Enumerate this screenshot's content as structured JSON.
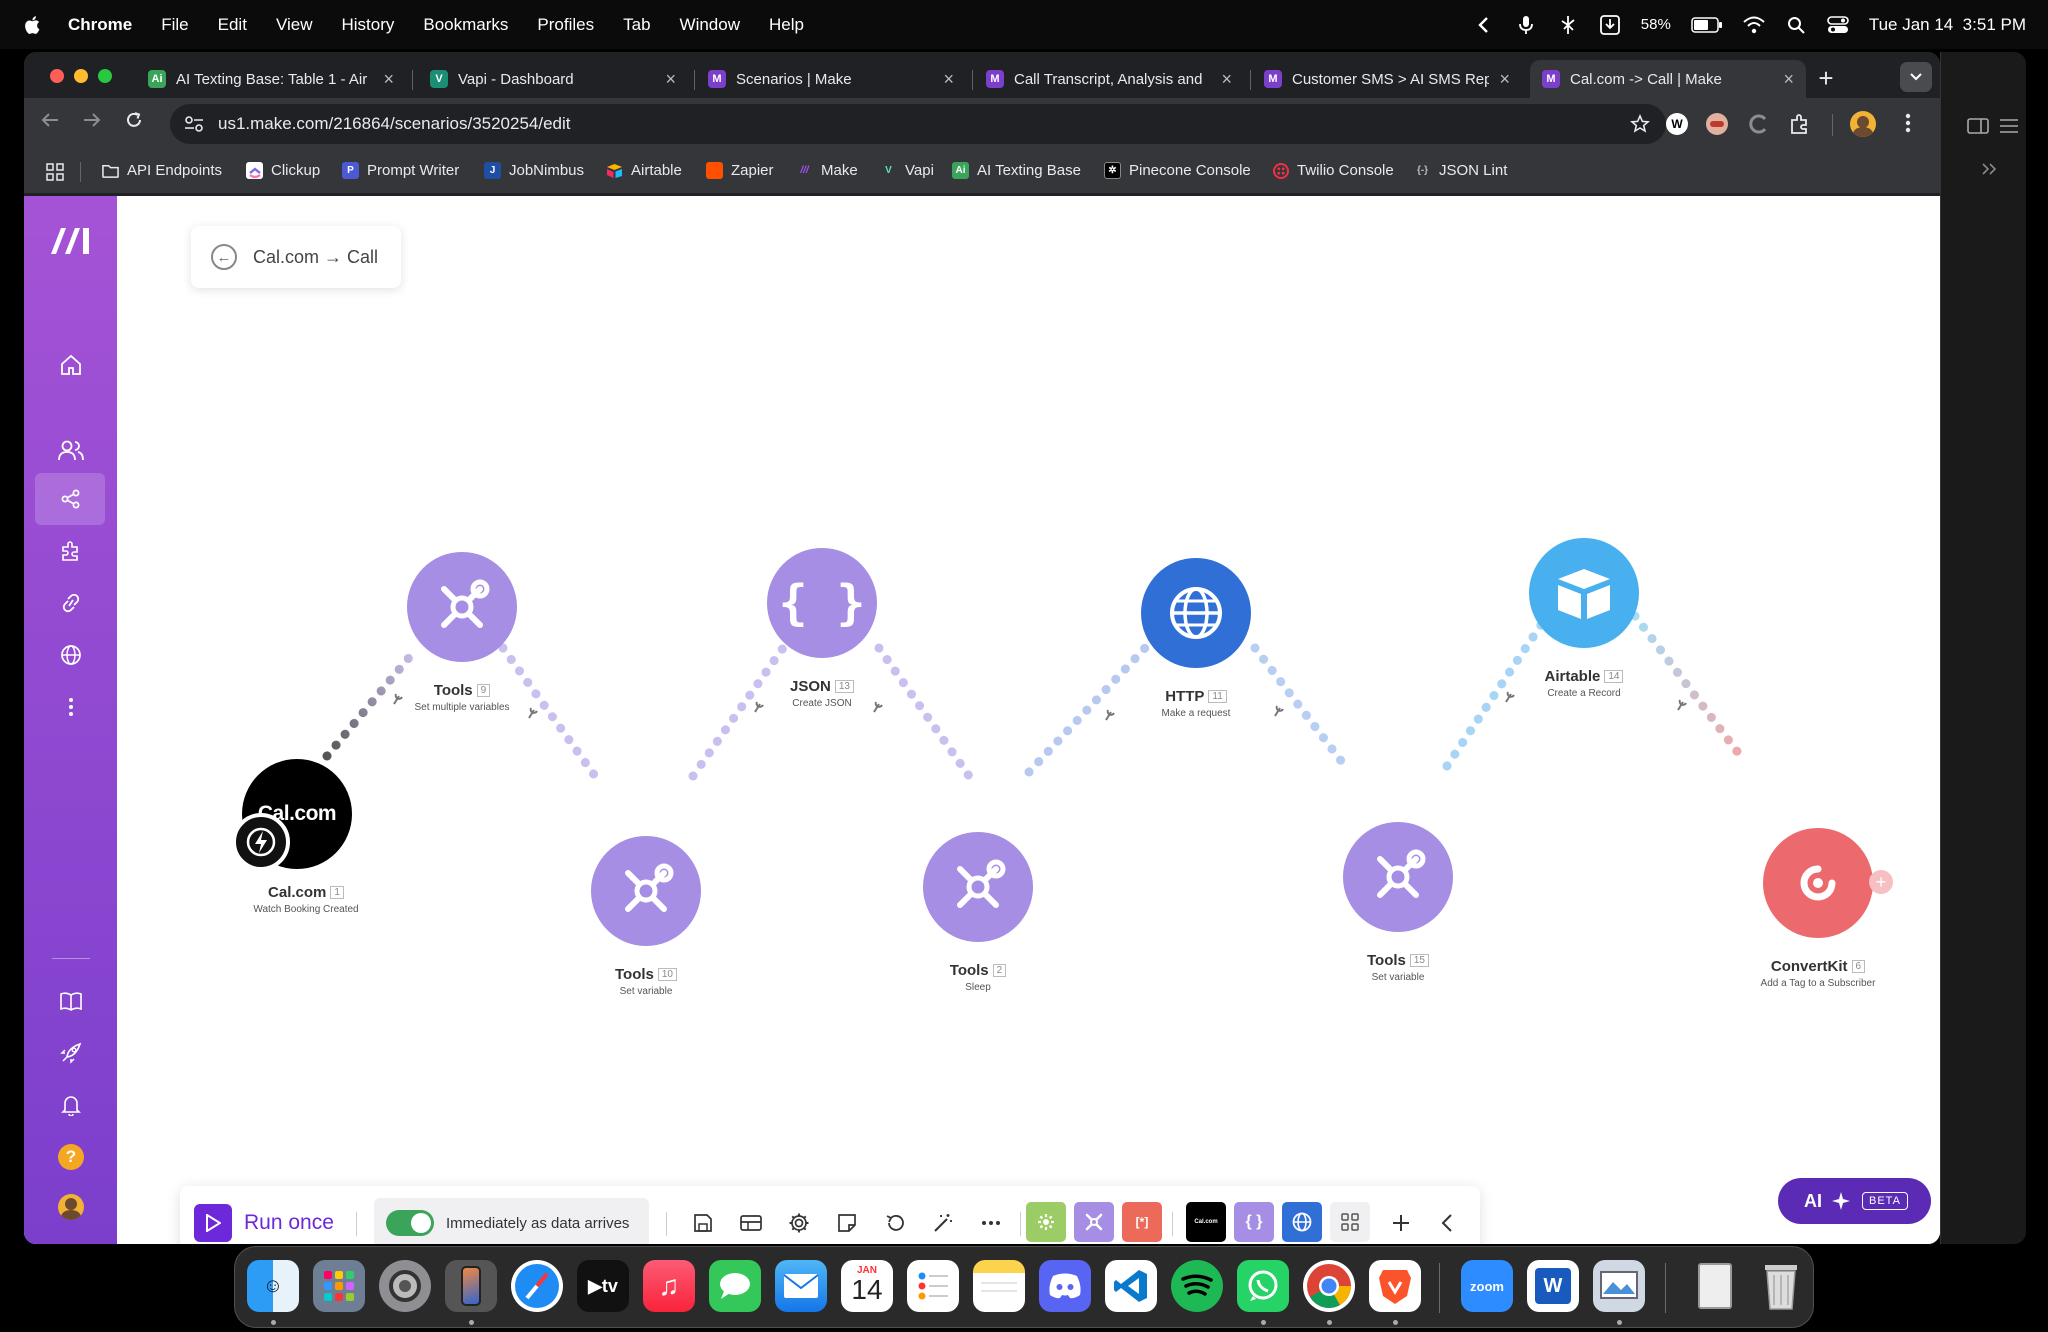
{
  "menubar": {
    "app": "Chrome",
    "items": [
      "File",
      "Edit",
      "View",
      "History",
      "Bookmarks",
      "Profiles",
      "Tab",
      "Window",
      "Help"
    ],
    "battery": "58%",
    "datetime": "Tue Jan 14  3:51 PM"
  },
  "tabs": [
    {
      "title": "AI Texting Base: Table 1 - Air",
      "fav": "Ai",
      "color": "#3aa55a"
    },
    {
      "title": "Vapi - Dashboard",
      "fav": "V",
      "color": "#1b8f76"
    },
    {
      "title": "Scenarios | Make",
      "fav": "M",
      "color": "#7b3fcc"
    },
    {
      "title": "Call Transcript, Analysis and",
      "fav": "M",
      "color": "#7b3fcc"
    },
    {
      "title": "Customer SMS > AI SMS Rep",
      "fav": "M",
      "color": "#7b3fcc"
    },
    {
      "title": "Cal.com -> Call | Make",
      "fav": "M",
      "color": "#7b3fcc"
    }
  ],
  "omnibox": {
    "url": "us1.make.com/216864/scenarios/3520254/edit"
  },
  "bookmarks": [
    {
      "label": "API Endpoints",
      "icon": "folder-icon"
    },
    {
      "label": "Clickup",
      "icon": "clickup-icon"
    },
    {
      "label": "Prompt Writer",
      "icon": "prompt-writer-icon"
    },
    {
      "label": "JobNimbus",
      "icon": "jobnimbus-icon"
    },
    {
      "label": "Airtable",
      "icon": "airtable-icon"
    },
    {
      "label": "Zapier",
      "icon": "zapier-icon"
    },
    {
      "label": "Make",
      "icon": "make-icon"
    },
    {
      "label": "Vapi",
      "icon": "vapi-icon"
    },
    {
      "label": "AI Texting Base",
      "icon": "ai-texting-icon"
    },
    {
      "label": "Pinecone Console",
      "icon": "pinecone-icon"
    },
    {
      "label": "Twilio Console",
      "icon": "twilio-icon"
    },
    {
      "label": "JSON Lint",
      "icon": "json-lint-icon"
    }
  ],
  "scenario": {
    "title": "Cal.com → Call"
  },
  "modules": [
    {
      "name": "Cal.com",
      "num": "1",
      "desc": "Watch Booking Created",
      "color": "#000000"
    },
    {
      "name": "Tools",
      "num": "9",
      "desc": "Set multiple variables",
      "color": "#a58ee3"
    },
    {
      "name": "Tools",
      "num": "10",
      "desc": "Set variable",
      "color": "#a58ee3"
    },
    {
      "name": "JSON",
      "num": "13",
      "desc": "Create JSON",
      "color": "#a58ee3"
    },
    {
      "name": "Tools",
      "num": "2",
      "desc": "Sleep",
      "color": "#a58ee3"
    },
    {
      "name": "HTTP",
      "num": "11",
      "desc": "Make a request",
      "color": "#2f6fd6"
    },
    {
      "name": "Tools",
      "num": "15",
      "desc": "Set variable",
      "color": "#a58ee3"
    },
    {
      "name": "Airtable",
      "num": "14",
      "desc": "Create a Record",
      "color": "#48b0ee"
    },
    {
      "name": "ConvertKit",
      "num": "6",
      "desc": "Add a Tag to a Subscriber",
      "color": "#ec6a6e"
    }
  ],
  "cal_logo": "Cal.com",
  "bottom": {
    "run_once": "Run once",
    "schedule": "Immediately as data arrives",
    "ai": "AI",
    "beta": "BETA"
  },
  "dock": {
    "calendar_month": "JAN",
    "calendar_day": "14",
    "zoom": "zoom"
  }
}
